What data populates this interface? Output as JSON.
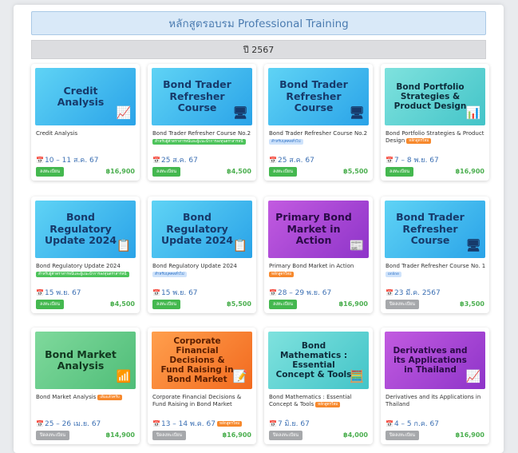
{
  "header": {
    "title": "หลักสูตรอบรม Professional Training"
  },
  "year": {
    "label": "ปี 2567"
  },
  "cards": [
    {
      "thumb_title": "Credit Analysis",
      "thumb_theme": "blue",
      "icon": "chart-analysis-icon",
      "icon_glyph": "📈",
      "name": "Credit Analysis",
      "tag": "",
      "tag_style": "",
      "name_tag": "",
      "date": "10 – 11 ส.ค. 67",
      "date_tag": "",
      "button": "ลงทะเบียน",
      "button_state": "open",
      "price": "฿16,900"
    },
    {
      "thumb_title": "Bond Trader Refresher Course",
      "thumb_theme": "blue",
      "icon": "trader-desk-icon",
      "icon_glyph": "🖥",
      "name": "Bond Trader Refresher Course No.2",
      "tag": "สำหรับผู้ค้าตราสารหนี้และผู้แนะนำการลงทุนตราสารหนี้",
      "tag_style": "green",
      "name_tag": "",
      "date": "25 ส.ค. 67",
      "date_tag": "",
      "button": "ลงทะเบียน",
      "button_state": "open",
      "price": "฿4,500"
    },
    {
      "thumb_title": "Bond Trader Refresher Course",
      "thumb_theme": "blue",
      "icon": "trader-desk-icon",
      "icon_glyph": "🖥",
      "name": "Bond Trader Refresher Course No.2",
      "tag": "สำหรับบุคคลทั่วไป",
      "tag_style": "blue",
      "name_tag": "",
      "date": "25 ส.ค. 67",
      "date_tag": "",
      "button": "ลงทะเบียน",
      "button_state": "open",
      "price": "฿5,500"
    },
    {
      "thumb_title": "Bond Portfolio Strategies & Product Design",
      "thumb_theme": "teal",
      "icon": "portfolio-icon",
      "icon_glyph": "📊",
      "name": "Bond Portfolio Strategies & Product Design",
      "tag": "",
      "tag_style": "",
      "name_tag": "หลักสูตรใหม่",
      "date": "7 – 8 พ.ย. 67",
      "date_tag": "",
      "button": "ลงทะเบียน",
      "button_state": "open",
      "price": "฿16,900"
    },
    {
      "thumb_title": "Bond Regulatory Update 2024",
      "thumb_theme": "blue",
      "icon": "regulation-doc-icon",
      "icon_glyph": "📋",
      "name": "Bond Regulatory Update 2024",
      "tag": "สำหรับผู้ค้าตราสารหนี้และผู้แนะนำการลงทุนตราสารหนี้",
      "tag_style": "green",
      "name_tag": "",
      "date": "15 พ.ย. 67",
      "date_tag": "",
      "button": "ลงทะเบียน",
      "button_state": "open",
      "price": "฿4,500"
    },
    {
      "thumb_title": "Bond Regulatory Update 2024",
      "thumb_theme": "blue",
      "icon": "regulation-doc-icon",
      "icon_glyph": "📋",
      "name": "Bond Regulatory Update 2024",
      "tag": "สำหรับบุคคลทั่วไป",
      "tag_style": "blue",
      "name_tag": "",
      "date": "15 พ.ย. 67",
      "date_tag": "",
      "button": "ลงทะเบียน",
      "button_state": "open",
      "price": "฿5,500"
    },
    {
      "thumb_title": "Primary Bond Market in Action",
      "thumb_theme": "purple",
      "icon": "market-board-icon",
      "icon_glyph": "📰",
      "name": "Primary Bond Market in Action",
      "tag": "หลักสูตรใหม่",
      "tag_style": "orange",
      "name_tag": "",
      "date": "28 – 29 พ.ย. 67",
      "date_tag": "",
      "button": "ลงทะเบียน",
      "button_state": "open",
      "price": "฿16,900"
    },
    {
      "thumb_title": "Bond Trader Refresher Course",
      "thumb_theme": "blue",
      "icon": "trader-desk-icon",
      "icon_glyph": "🖥",
      "name": "Bond Trader Refresher Course No. 1",
      "tag": "online",
      "tag_style": "blue",
      "name_tag": "",
      "date": "23 มี.ค. 2567",
      "date_tag": "",
      "button": "ปิดลงทะเบียน",
      "button_state": "closed",
      "price": "฿3,500"
    },
    {
      "thumb_title": "Bond Market Analysis",
      "thumb_theme": "green",
      "icon": "bar-growth-icon",
      "icon_glyph": "📶",
      "name": "Bond Market Analysis",
      "tag": "",
      "tag_style": "",
      "name_tag": "เต็มแล้วครับ",
      "date": "25 – 26 เม.ย. 67",
      "date_tag": "",
      "button": "ปิดลงทะเบียน",
      "button_state": "closed",
      "price": "฿14,900"
    },
    {
      "thumb_title": "Corporate Financial Decisions & Fund Raising in Bond Market",
      "thumb_theme": "orange",
      "icon": "finance-doc-icon",
      "icon_glyph": "📝",
      "name": "Corporate Financial Decisions & Fund Raising in Bond Market",
      "tag": "",
      "tag_style": "",
      "name_tag": "",
      "date": "13 – 14 พ.ค. 67",
      "date_tag": "หลักสูตรใหม่",
      "button": "ปิดลงทะเบียน",
      "button_state": "closed",
      "price": "฿16,900"
    },
    {
      "thumb_title": "Bond Mathematics : Essential Concept & Tools",
      "thumb_theme": "teal",
      "icon": "calculator-icon",
      "icon_glyph": "🧮",
      "name": "Bond Mathematics : Essential Concept & Tools",
      "tag": "",
      "tag_style": "",
      "name_tag": "หลักสูตรใหม่",
      "date": "7 มิ.ย. 67",
      "date_tag": "",
      "button": "ปิดลงทะเบียน",
      "button_state": "closed",
      "price": "฿4,000"
    },
    {
      "thumb_title": "Derivatives and its Applications in Thailand",
      "thumb_theme": "purple",
      "icon": "presentation-chart-icon",
      "icon_glyph": "📈",
      "name": "Derivatives and its Applications in Thailand",
      "tag": "",
      "tag_style": "",
      "name_tag": "",
      "date": "4 – 5 ก.ค. 67",
      "date_tag": "",
      "button": "ปิดลงทะเบียน",
      "button_state": "closed",
      "price": "฿16,900"
    }
  ]
}
